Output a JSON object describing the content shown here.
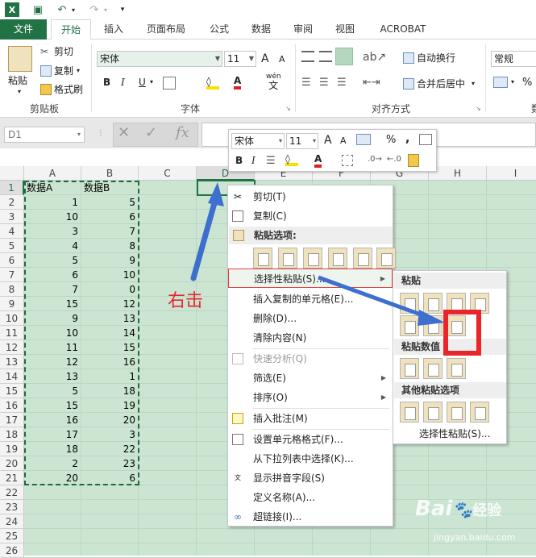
{
  "quick_access": {
    "excel_icon": "excel-icon",
    "save": "save-icon",
    "undo": "undo-icon",
    "redo": "redo-icon",
    "customize": "customize-qat-icon"
  },
  "tabs": [
    {
      "label": "文件"
    },
    {
      "label": "开始"
    },
    {
      "label": "插入"
    },
    {
      "label": "页面布局"
    },
    {
      "label": "公式"
    },
    {
      "label": "数据"
    },
    {
      "label": "审阅"
    },
    {
      "label": "视图"
    },
    {
      "label": "ACROBAT"
    }
  ],
  "ribbon": {
    "clipboard": {
      "paste": "粘贴",
      "cut": "剪切",
      "copy": "复制",
      "format_painter": "格式刷",
      "group": "剪贴板"
    },
    "font": {
      "name": "宋体",
      "size": "11",
      "group": "字体",
      "bold": "B",
      "italic": "I",
      "underline": "U",
      "font_color_a": "A",
      "grow": "A",
      "shrink": "A",
      "wen": "wén",
      "wen2": "文"
    },
    "alignment": {
      "wrap": "自动换行",
      "merge": "合并后居中",
      "group": "对齐方式"
    },
    "number": {
      "format": "常规",
      "percent": "%",
      "group": "数"
    }
  },
  "formula_bar": {
    "name_box": "D1",
    "fx": "fx",
    "cancel": "✕",
    "enter": "✓"
  },
  "columns": [
    "A",
    "B",
    "C",
    "D",
    "E",
    "F",
    "G",
    "H",
    "I"
  ],
  "rows": [
    "1",
    "2",
    "3",
    "4",
    "5",
    "6",
    "7",
    "8",
    "9",
    "10",
    "11",
    "12",
    "13",
    "14",
    "15",
    "16",
    "17",
    "18",
    "19",
    "20",
    "21",
    "22",
    "23",
    "24",
    "25",
    "26"
  ],
  "sheet": {
    "headers": {
      "a": "数据A",
      "b": "数据B"
    },
    "col_a": [
      "1",
      "10",
      "3",
      "4",
      "5",
      "6",
      "7",
      "15",
      "9",
      "10",
      "11",
      "12",
      "13",
      "5",
      "15",
      "16",
      "17",
      "18",
      "2",
      "20"
    ],
    "col_b": [
      "5",
      "6",
      "7",
      "8",
      "9",
      "10",
      "0",
      "12",
      "13",
      "14",
      "15",
      "16",
      "1",
      "18",
      "19",
      "20",
      "3",
      "22",
      "23",
      "6"
    ]
  },
  "mini_toolbar": {
    "font": "宋体",
    "size": "11",
    "grow": "A",
    "shrink": "A",
    "percent": "%",
    "comma": ",",
    "bold": "B",
    "italic": "I",
    "font_color": "A"
  },
  "annotation": {
    "text": "右击"
  },
  "context_menu": {
    "cut": "剪切(T)",
    "copy": "复制(C)",
    "paste_options": "粘贴选项:",
    "paste_special": "选择性粘贴(S)...",
    "insert_copied": "插入复制的单元格(E)...",
    "delete": "删除(D)...",
    "clear": "清除内容(N)",
    "quick_analysis": "快速分析(Q)",
    "filter": "筛选(E)",
    "sort": "排序(O)",
    "insert_comment": "插入批注(M)",
    "format_cells": "设置单元格格式(F)...",
    "pick_list": "从下拉列表中选择(K)...",
    "phonetic": "显示拼音字段(S)",
    "define_name": "定义名称(A)...",
    "hyperlink": "超链接(I)..."
  },
  "submenu": {
    "paste": "粘贴",
    "paste_values": "粘贴数值",
    "other": "其他粘贴选项",
    "paste_special": "选择性粘贴(S)..."
  },
  "watermark": {
    "brand": "Bai",
    "brand2": "经验",
    "url": "jingyan.baidu.com"
  },
  "colors": {
    "excel_green": "#217346",
    "grid_bg": "#cce5d3",
    "highlight": "#e8262a",
    "arrow": "#3d6fcf",
    "annotation": "#e8262a"
  }
}
